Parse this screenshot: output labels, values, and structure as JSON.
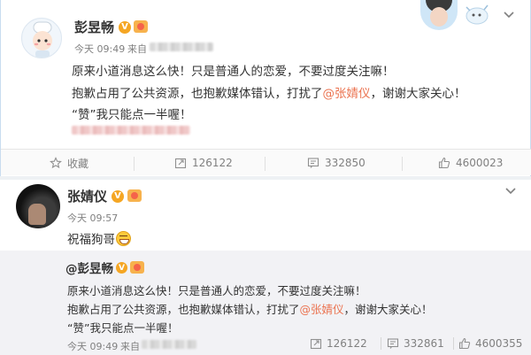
{
  "post": {
    "author": "彭昱畅",
    "time": "今天 09:49",
    "source_prefix": "来自",
    "lines": [
      "原来小道消息这么快！只是普通人的恋爱，不要过度关注嘛！",
      "抱歉占用了公共资源，也抱歉媒体错认，打扰了",
      "@张婧仪",
      "，谢谢大家关心！",
      "“赞”我只能点一半喔！"
    ],
    "actions": {
      "favorite_label": "收藏",
      "repost_count": "126122",
      "comment_count": "332850",
      "like_count": "4600023"
    }
  },
  "comment": {
    "author": "张婧仪",
    "time": "今天 09:57",
    "text": "祝福狗哥",
    "emoji_icon": "grin-emoji-icon"
  },
  "quoted": {
    "author": "@彭昱畅",
    "lines": [
      "原来小道消息这么快！只是普通人的恋爱，不要过度关注嘛！",
      "抱歉占用了公共资源，也抱歉媒体错认，打扰了",
      "@张婧仪",
      "，谢谢大家关心！",
      "“赞”我只能点一半喔！"
    ],
    "time": "今天 09:49",
    "source_prefix": "来自",
    "repost_count": "126122",
    "comment_count": "332861",
    "like_count": "4600355"
  },
  "colors": {
    "mention": "#eb7350",
    "verified_badge": "#f5a623",
    "quote_background": "#f2f2f5",
    "meta_text": "#808080"
  }
}
